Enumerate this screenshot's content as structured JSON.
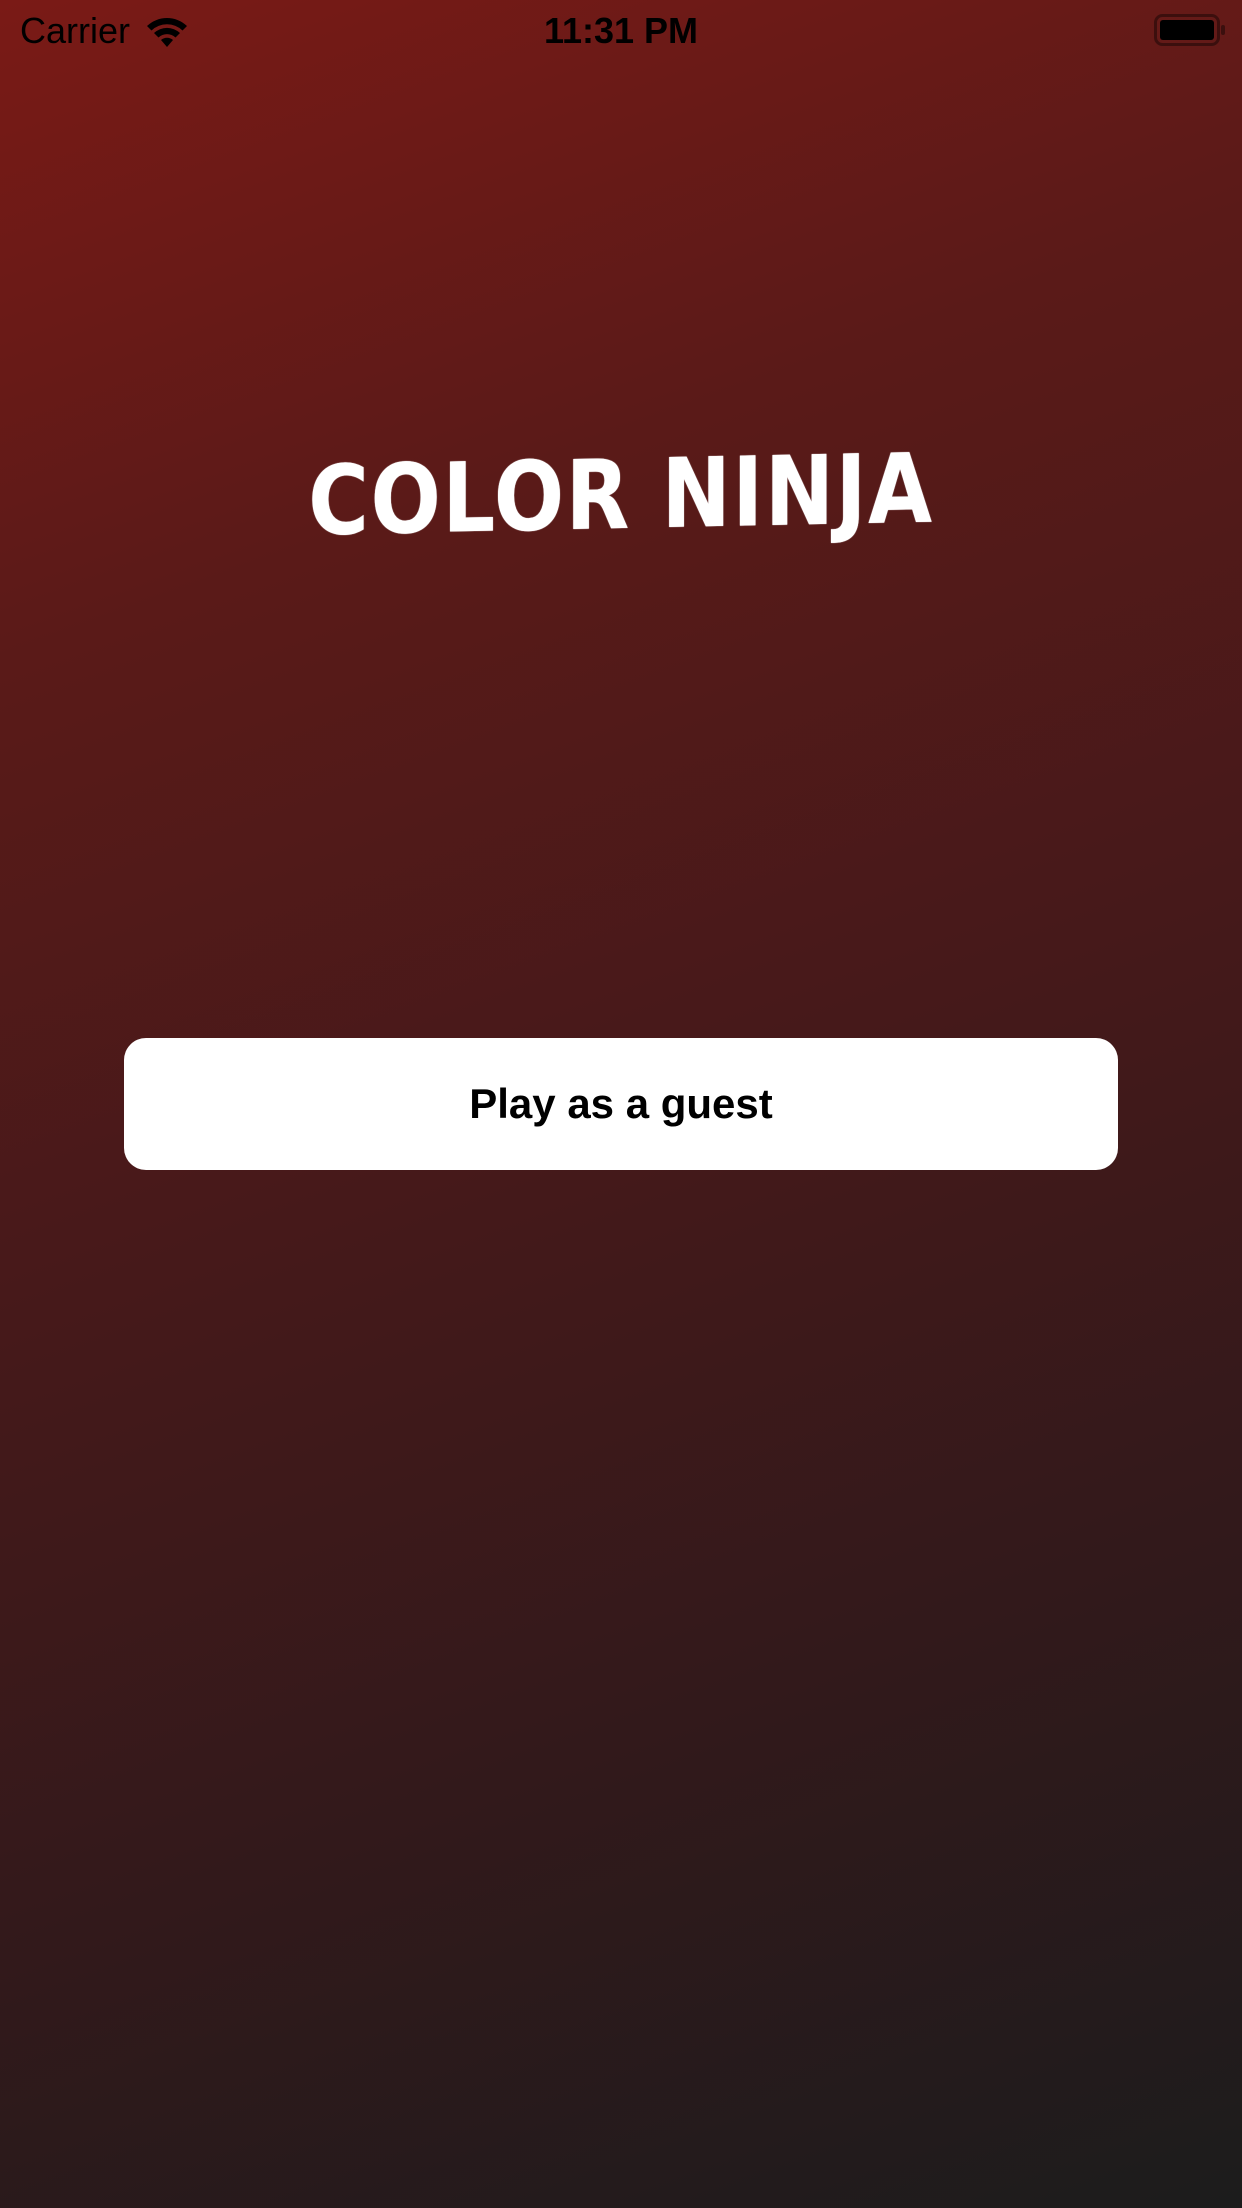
{
  "status_bar": {
    "carrier": "Carrier",
    "time": "11:31 PM",
    "wifi_icon": "wifi-icon",
    "battery_icon": "battery-icon"
  },
  "app": {
    "title": "COLOR NINJA"
  },
  "actions": {
    "guest_button_label": "Play as a guest"
  },
  "colors": {
    "background_top_left": "#7a1a16",
    "background_bottom_right": "#1c1c1c",
    "button_background": "#ffffff",
    "button_text": "#000000",
    "title_color": "#ffffff"
  }
}
